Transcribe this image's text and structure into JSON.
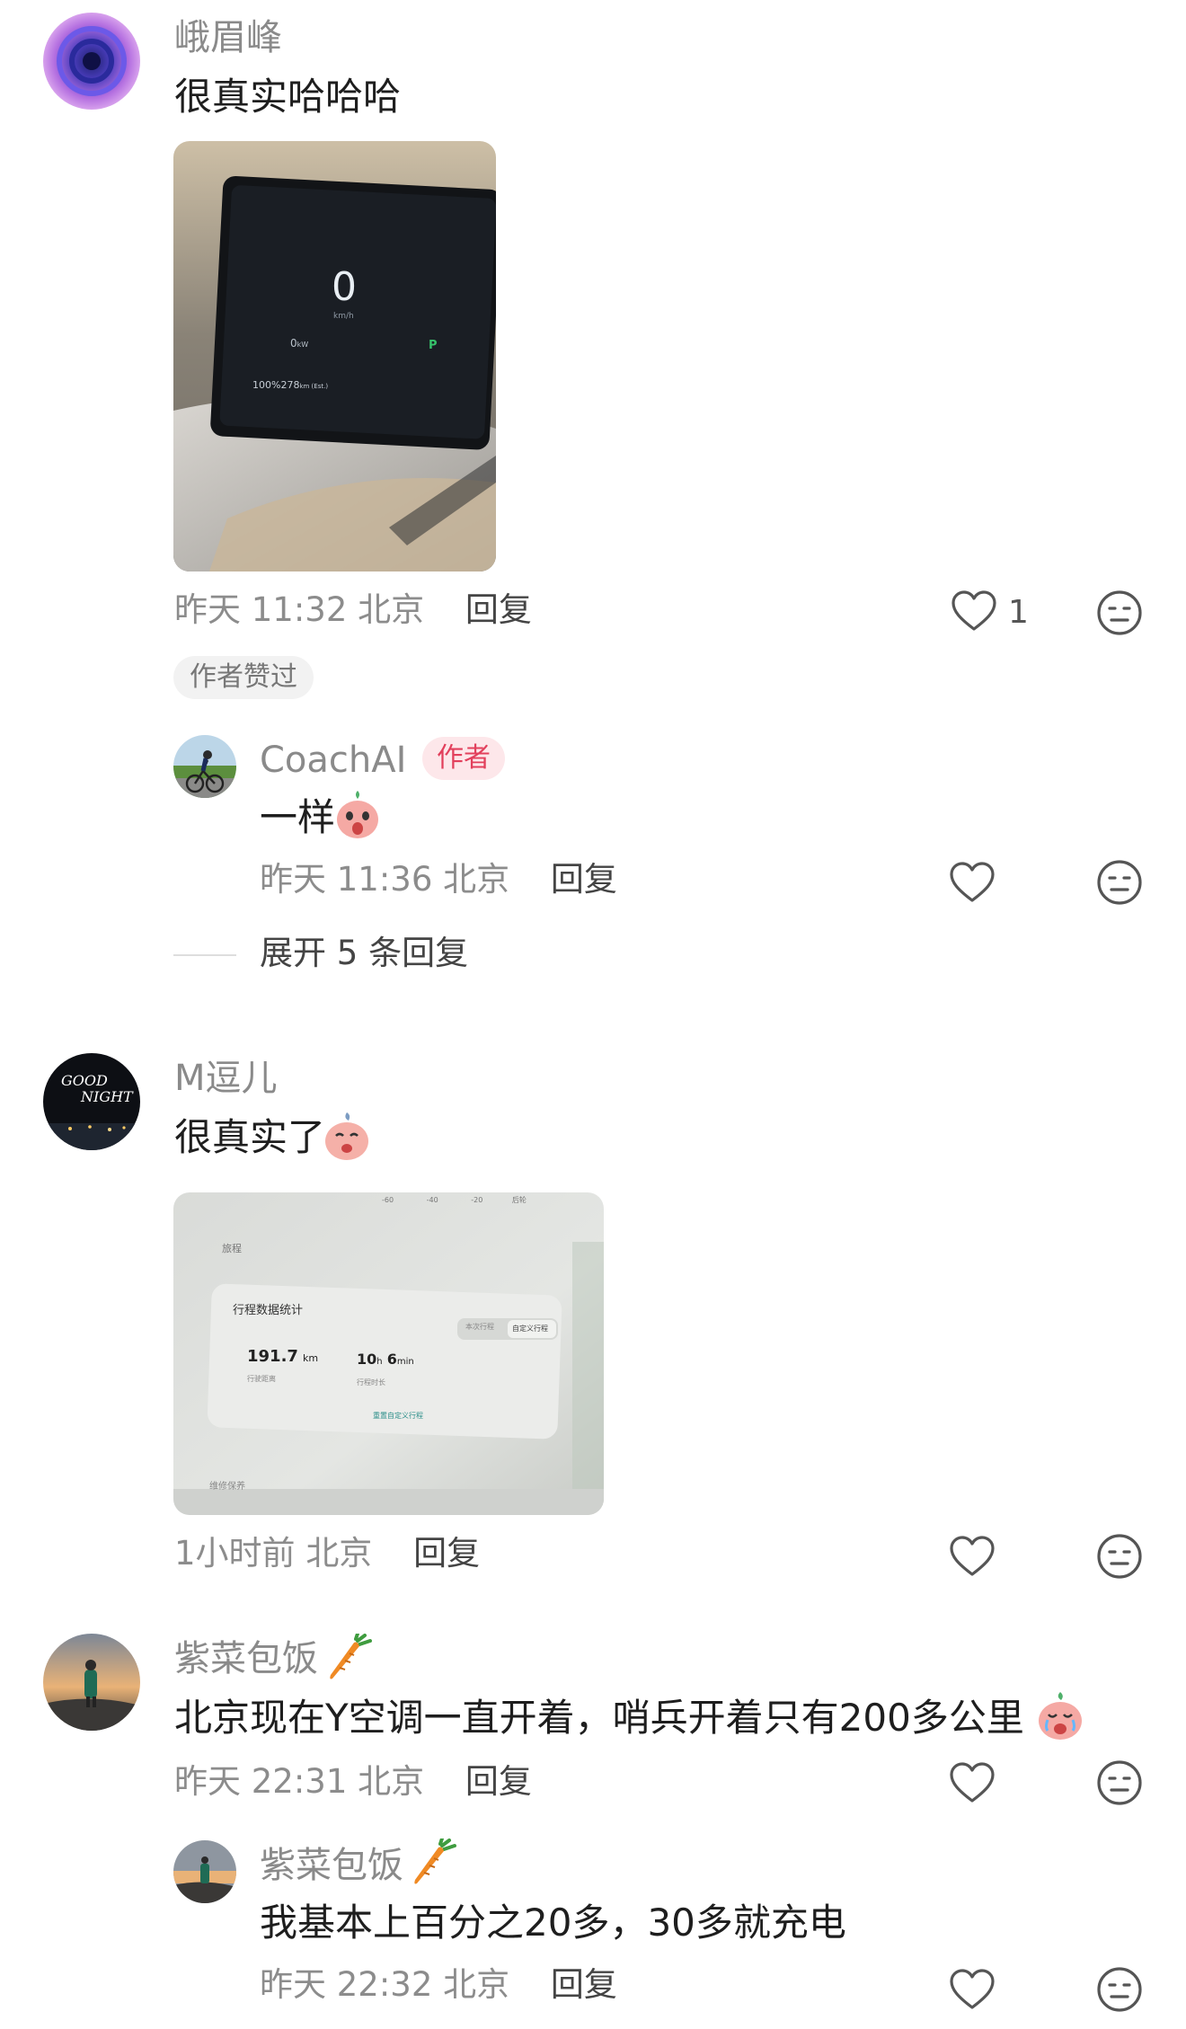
{
  "comments": [
    {
      "username": "峨眉峰",
      "text": "很真实哈哈哈",
      "time": "昨天 11:32",
      "location": "北京",
      "reply": "回复",
      "likes": "1",
      "liked_by_author": "作者赞过",
      "photo": {
        "speed": "0",
        "speed_unit": "km/h",
        "power": "0",
        "power_unit": "kW",
        "gear": "P",
        "battery": "100",
        "range": "278",
        "range_unit": "km (Est.)"
      },
      "replies": [
        {
          "username": "CoachAI",
          "badge": "作者",
          "text": "一样",
          "time": "昨天 11:36",
          "location": "北京",
          "reply": "回复"
        }
      ],
      "expand": "展开 5 条回复"
    },
    {
      "username": "M逗儿",
      "text": "很真实了",
      "time": "1小时前",
      "location": "北京",
      "reply": "回复",
      "photo": {
        "scale": [
          "-60",
          "-40",
          "-20",
          "后轮"
        ],
        "section_title": "旅程",
        "card_title": "行程数据统计",
        "tab1": "本次行程",
        "tab2": "自定义行程",
        "distance_value": "191.7",
        "distance_unit": "km",
        "distance_label": "行驶距离",
        "duration_h": "10",
        "duration_h_unit": "h",
        "duration_m": "6",
        "duration_m_unit": "min",
        "duration_label": "行程时长",
        "reset_link": "重置自定义行程",
        "footer_label": "维修保养"
      }
    },
    {
      "username": "紫菜包饭",
      "text": "北京现在Y空调一直开着，哨兵开着只有200多公里",
      "time": "昨天 22:31",
      "location": "北京",
      "reply": "回复",
      "replies": [
        {
          "username": "紫菜包饭",
          "text": "我基本上百分之20多，30多就充电",
          "time": "昨天 22:32",
          "location": "北京",
          "reply": "回复"
        }
      ]
    }
  ],
  "icons": {
    "like": "heart-outline-icon",
    "dislike": "neutral-face-icon",
    "carrot": "carrot-emoji",
    "sticker": "pink-face-sticker"
  },
  "colors": {
    "author_badge_bg": "#fde7ea",
    "author_badge_text": "#e2405c",
    "meta_text": "#8c8c8c"
  }
}
